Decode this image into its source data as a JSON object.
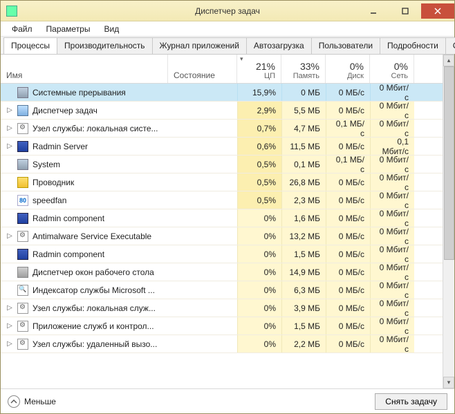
{
  "window": {
    "title": "Диспетчер задач"
  },
  "menu": {
    "file": "Файл",
    "options": "Параметры",
    "view": "Вид"
  },
  "tabs": [
    {
      "label": "Процессы",
      "active": true
    },
    {
      "label": "Производительность"
    },
    {
      "label": "Журнал приложений"
    },
    {
      "label": "Автозагрузка"
    },
    {
      "label": "Пользователи"
    },
    {
      "label": "Подробности"
    },
    {
      "label": "С"
    }
  ],
  "columns": {
    "name": "Имя",
    "state": "Состояние",
    "cpu": {
      "value": "21%",
      "label": "ЦП"
    },
    "memory": {
      "value": "33%",
      "label": "Память"
    },
    "disk": {
      "value": "0%",
      "label": "Диск"
    },
    "network": {
      "value": "0%",
      "label": "Сеть"
    }
  },
  "rows": [
    {
      "icon": "sys",
      "name": "Системные прерывания",
      "cpu": "15,9%",
      "mem": "0 МБ",
      "disk": "0 МБ/с",
      "net": "0 Мбит/с",
      "selected": true,
      "heat_cpu": 2
    },
    {
      "expand": true,
      "icon": "tm",
      "name": "Диспетчер задач",
      "cpu": "2,9%",
      "mem": "5,5 МБ",
      "disk": "0 МБ/с",
      "net": "0 Мбит/с",
      "heat_cpu": 1
    },
    {
      "expand": true,
      "icon": "svc",
      "name": "Узел службы: локальная систе...",
      "cpu": "0,7%",
      "mem": "4,7 МБ",
      "disk": "0,1 МБ/с",
      "net": "0 Мбит/с",
      "heat_cpu": 1
    },
    {
      "expand": true,
      "icon": "rad",
      "name": "Radmin Server",
      "cpu": "0,6%",
      "mem": "11,5 МБ",
      "disk": "0 МБ/с",
      "net": "0,1 Мбит/с",
      "heat_cpu": 1
    },
    {
      "icon": "sys",
      "name": "System",
      "cpu": "0,5%",
      "mem": "0,1 МБ",
      "disk": "0,1 МБ/с",
      "net": "0 Мбит/с",
      "heat_cpu": 1
    },
    {
      "icon": "exp",
      "name": "Проводник",
      "cpu": "0,5%",
      "mem": "26,8 МБ",
      "disk": "0 МБ/с",
      "net": "0 Мбит/с",
      "heat_cpu": 1
    },
    {
      "icon": "sf",
      "name": "speedfan",
      "cpu": "0,5%",
      "mem": "2,3 МБ",
      "disk": "0 МБ/с",
      "net": "0 Мбит/с",
      "heat_cpu": 1
    },
    {
      "icon": "rad",
      "name": "Radmin component",
      "cpu": "0%",
      "mem": "1,6 МБ",
      "disk": "0 МБ/с",
      "net": "0 Мбит/с"
    },
    {
      "expand": true,
      "icon": "svc",
      "name": "Antimalware Service Executable",
      "cpu": "0%",
      "mem": "13,2 МБ",
      "disk": "0 МБ/с",
      "net": "0 Мбит/с"
    },
    {
      "icon": "rad",
      "name": "Radmin component",
      "cpu": "0%",
      "mem": "1,5 МБ",
      "disk": "0 МБ/с",
      "net": "0 Мбит/с"
    },
    {
      "icon": "dwm",
      "name": "Диспетчер окон рабочего стола",
      "cpu": "0%",
      "mem": "14,9 МБ",
      "disk": "0 МБ/с",
      "net": "0 Мбит/с"
    },
    {
      "icon": "idx",
      "name": "Индексатор службы Microsoft ...",
      "cpu": "0%",
      "mem": "6,3 МБ",
      "disk": "0 МБ/с",
      "net": "0 Мбит/с"
    },
    {
      "expand": true,
      "icon": "svc",
      "name": "Узел службы: локальная служ...",
      "cpu": "0%",
      "mem": "3,9 МБ",
      "disk": "0 МБ/с",
      "net": "0 Мбит/с"
    },
    {
      "expand": true,
      "icon": "svc",
      "name": "Приложение служб и контрол...",
      "cpu": "0%",
      "mem": "1,5 МБ",
      "disk": "0 МБ/с",
      "net": "0 Мбит/с"
    },
    {
      "expand": true,
      "icon": "svc",
      "name": "Узел службы: удаленный вызо...",
      "cpu": "0%",
      "mem": "2,2 МБ",
      "disk": "0 МБ/с",
      "net": "0 Мбит/с"
    }
  ],
  "footer": {
    "less": "Меньше",
    "end_task": "Снять задачу"
  }
}
